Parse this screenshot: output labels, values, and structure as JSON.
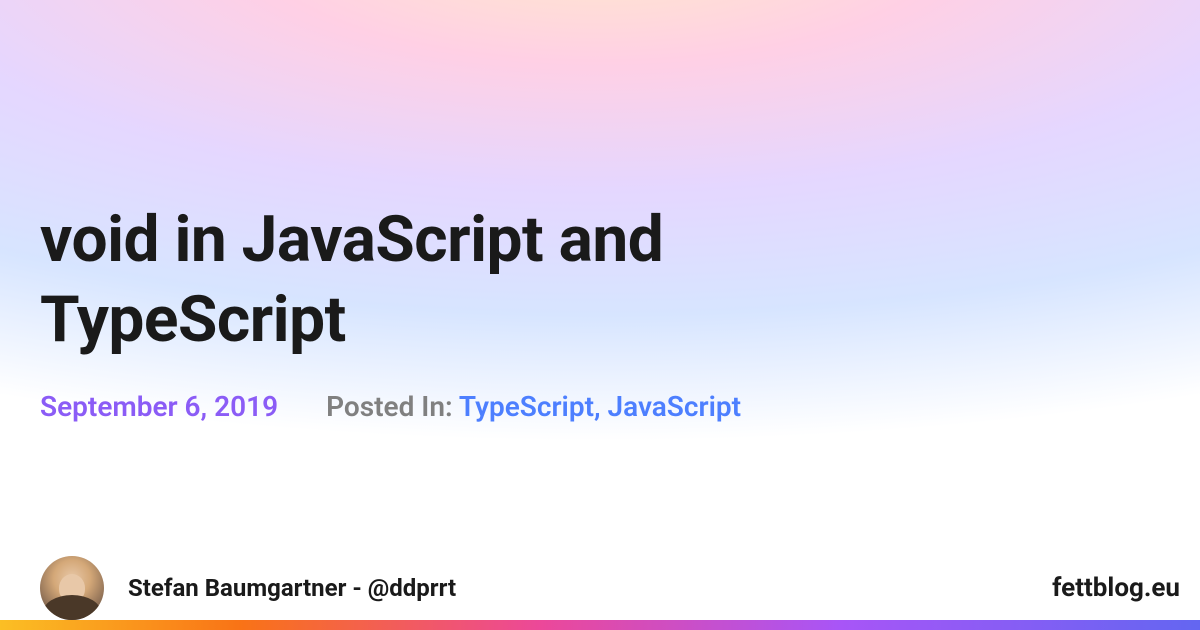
{
  "article": {
    "title": "void in JavaScript and TypeScript",
    "date": "September 6, 2019",
    "posted_in_label": "Posted In:",
    "tags": "TypeScript, JavaScript"
  },
  "author": {
    "name": "Stefan Baumgartner",
    "handle": "@ddprrt",
    "display": "Stefan Baumgartner - @ddprrt"
  },
  "site": {
    "name": "fettblog.eu"
  }
}
